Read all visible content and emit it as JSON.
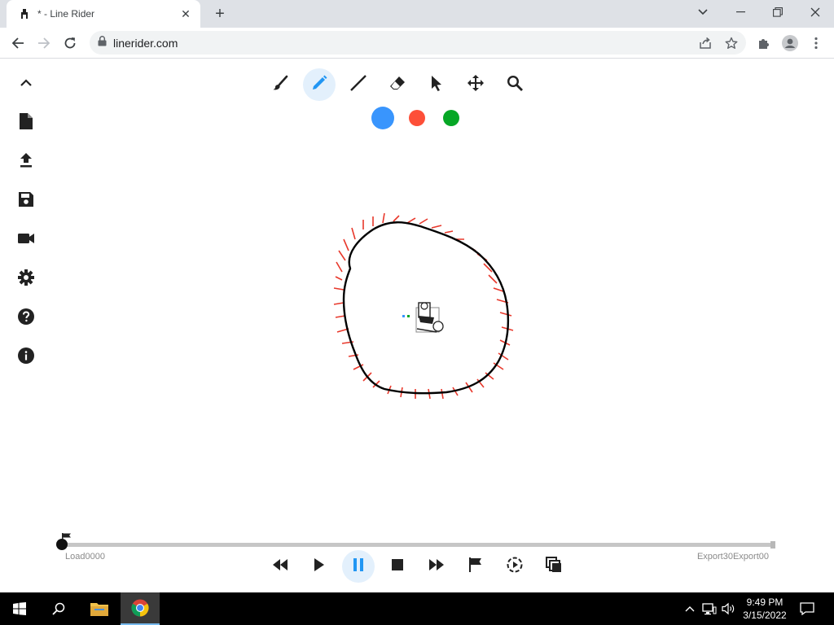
{
  "browser": {
    "tab_title": "* - Line Rider",
    "tab_close_glyph": "✕",
    "new_tab_glyph": "+",
    "url": "linerider.com"
  },
  "toolbar": {
    "tools": [
      {
        "name": "brush-icon",
        "active": false
      },
      {
        "name": "pencil-icon",
        "active": true
      },
      {
        "name": "line-icon",
        "active": false
      },
      {
        "name": "eraser-icon",
        "active": false
      },
      {
        "name": "select-pointer-icon",
        "active": false
      },
      {
        "name": "pan-icon",
        "active": false
      },
      {
        "name": "zoom-icon",
        "active": false
      }
    ],
    "line_colors": [
      "#3995fd",
      "#fd4f38",
      "#06a725"
    ]
  },
  "sidebar": {
    "items": [
      "collapse-icon",
      "new-file-icon",
      "upload-icon",
      "save-icon",
      "video-camera-icon",
      "settings-gear-icon",
      "help-icon",
      "info-icon"
    ]
  },
  "timeline": {
    "start_label": "Load0000",
    "end_label": "Export30Export00",
    "position": 0.0
  },
  "playback": {
    "controls": [
      "rewind-icon",
      "play-icon",
      "pause-icon",
      "stop-icon",
      "fast-forward-icon",
      "flag-icon",
      "slow-motion-icon",
      "onion-skin-icon"
    ],
    "active": "pause-icon"
  },
  "taskbar": {
    "time": "9:49 PM",
    "date": "3/15/2022"
  },
  "colors": {
    "accent": "#2196f3",
    "active_bg": "#e3f0fc",
    "scenery_line": "#e8382b",
    "track_line": "#000000"
  }
}
